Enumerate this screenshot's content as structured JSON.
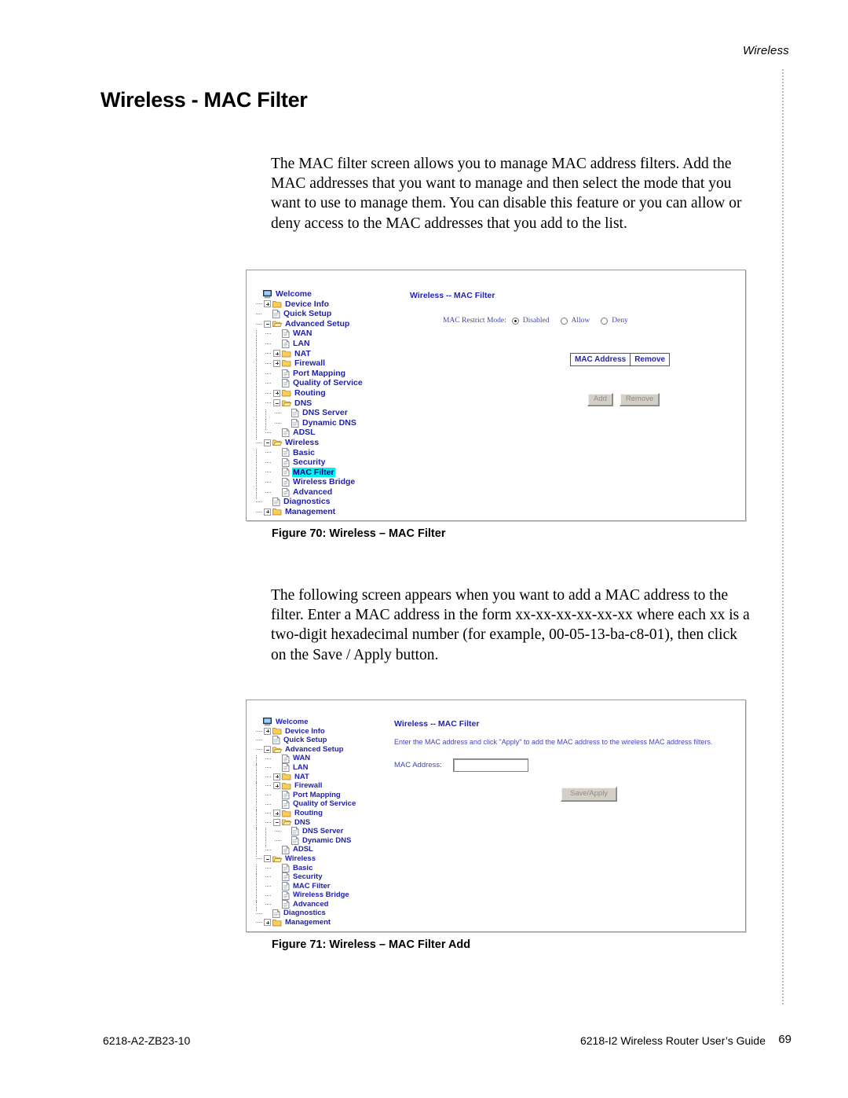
{
  "page": {
    "running_header": "Wireless",
    "title": "Wireless - MAC Filter",
    "paragraph_1": "The MAC filter screen allows you to manage MAC address filters. Add the MAC addresses that you want to manage and then select the mode that you want to use to manage them. You can disable this feature or you can allow or deny access to the MAC addresses that you add to the list.",
    "paragraph_2": "The following screen appears when you want to add a MAC address to the filter. Enter a MAC address in the form xx-xx-xx-xx-xx-xx where each xx is a two-digit hexadecimal number (for example, 00-05-13-ba-c8-01), then click on the Save / Apply button."
  },
  "figure_1": {
    "caption": "Figure 70: Wireless – MAC Filter",
    "panel_title": "Wireless -- MAC Filter",
    "restrict_label": "MAC Restrict Mode:",
    "radios": [
      {
        "label": "Disabled",
        "selected": true
      },
      {
        "label": "Allow",
        "selected": false
      },
      {
        "label": "Deny",
        "selected": false
      }
    ],
    "table_headers": [
      "MAC Address",
      "Remove"
    ],
    "buttons": [
      "Add",
      "Remove"
    ],
    "tree": [
      {
        "label": "Welcome",
        "depth": 0,
        "icon": "computer-icon",
        "toggle": "none"
      },
      {
        "label": "Device Info",
        "depth": 1,
        "icon": "folder-closed-icon",
        "toggle": "plus"
      },
      {
        "label": "Quick Setup",
        "depth": 1,
        "icon": "page-icon",
        "toggle": "none"
      },
      {
        "label": "Advanced Setup",
        "depth": 1,
        "icon": "folder-open-icon",
        "toggle": "minus"
      },
      {
        "label": "WAN",
        "depth": 2,
        "icon": "page-icon",
        "toggle": "none"
      },
      {
        "label": "LAN",
        "depth": 2,
        "icon": "page-icon",
        "toggle": "none"
      },
      {
        "label": "NAT",
        "depth": 2,
        "icon": "folder-closed-icon",
        "toggle": "plus"
      },
      {
        "label": "Firewall",
        "depth": 2,
        "icon": "folder-closed-icon",
        "toggle": "plus"
      },
      {
        "label": "Port Mapping",
        "depth": 2,
        "icon": "page-icon",
        "toggle": "none"
      },
      {
        "label": "Quality of Service",
        "depth": 2,
        "icon": "page-icon",
        "toggle": "none"
      },
      {
        "label": "Routing",
        "depth": 2,
        "icon": "folder-closed-icon",
        "toggle": "plus"
      },
      {
        "label": "DNS",
        "depth": 2,
        "icon": "folder-open-icon",
        "toggle": "minus"
      },
      {
        "label": "DNS Server",
        "depth": 3,
        "icon": "page-icon",
        "toggle": "none"
      },
      {
        "label": "Dynamic DNS",
        "depth": 3,
        "icon": "page-icon",
        "toggle": "none"
      },
      {
        "label": "ADSL",
        "depth": 2,
        "icon": "page-icon",
        "toggle": "none"
      },
      {
        "label": "Wireless",
        "depth": 1,
        "icon": "folder-open-icon",
        "toggle": "minus"
      },
      {
        "label": "Basic",
        "depth": 2,
        "icon": "page-icon",
        "toggle": "none"
      },
      {
        "label": "Security",
        "depth": 2,
        "icon": "page-icon",
        "toggle": "none"
      },
      {
        "label": "MAC Filter",
        "depth": 2,
        "icon": "page-icon",
        "toggle": "none",
        "selected": true
      },
      {
        "label": "Wireless Bridge",
        "depth": 2,
        "icon": "page-icon",
        "toggle": "none"
      },
      {
        "label": "Advanced",
        "depth": 2,
        "icon": "page-icon",
        "toggle": "none"
      },
      {
        "label": "Diagnostics",
        "depth": 1,
        "icon": "page-icon",
        "toggle": "none"
      },
      {
        "label": "Management",
        "depth": 1,
        "icon": "folder-closed-icon",
        "toggle": "plus"
      }
    ]
  },
  "figure_2": {
    "caption": "Figure 71: Wireless – MAC Filter Add",
    "panel_title": "Wireless -- MAC Filter",
    "help_text": "Enter the MAC address and click \"Apply\" to add the MAC address to the wireless MAC address filters.",
    "field_label": "MAC Address:",
    "field_value": "",
    "button": "Save/Apply",
    "tree": [
      {
        "label": "Welcome",
        "depth": 0,
        "icon": "computer-icon",
        "toggle": "none"
      },
      {
        "label": "Device Info",
        "depth": 1,
        "icon": "folder-closed-icon",
        "toggle": "plus"
      },
      {
        "label": "Quick Setup",
        "depth": 1,
        "icon": "page-icon",
        "toggle": "none"
      },
      {
        "label": "Advanced Setup",
        "depth": 1,
        "icon": "folder-open-icon",
        "toggle": "minus"
      },
      {
        "label": "WAN",
        "depth": 2,
        "icon": "page-icon",
        "toggle": "none"
      },
      {
        "label": "LAN",
        "depth": 2,
        "icon": "page-icon",
        "toggle": "none"
      },
      {
        "label": "NAT",
        "depth": 2,
        "icon": "folder-closed-icon",
        "toggle": "plus"
      },
      {
        "label": "Firewall",
        "depth": 2,
        "icon": "folder-closed-icon",
        "toggle": "plus"
      },
      {
        "label": "Port Mapping",
        "depth": 2,
        "icon": "page-icon",
        "toggle": "none"
      },
      {
        "label": "Quality of Service",
        "depth": 2,
        "icon": "page-icon",
        "toggle": "none"
      },
      {
        "label": "Routing",
        "depth": 2,
        "icon": "folder-closed-icon",
        "toggle": "plus"
      },
      {
        "label": "DNS",
        "depth": 2,
        "icon": "folder-open-icon",
        "toggle": "minus"
      },
      {
        "label": "DNS Server",
        "depth": 3,
        "icon": "page-icon",
        "toggle": "none"
      },
      {
        "label": "Dynamic DNS",
        "depth": 3,
        "icon": "page-icon",
        "toggle": "none"
      },
      {
        "label": "ADSL",
        "depth": 2,
        "icon": "page-icon",
        "toggle": "none"
      },
      {
        "label": "Wireless",
        "depth": 1,
        "icon": "folder-open-icon",
        "toggle": "minus"
      },
      {
        "label": "Basic",
        "depth": 2,
        "icon": "page-icon",
        "toggle": "none"
      },
      {
        "label": "Security",
        "depth": 2,
        "icon": "page-icon",
        "toggle": "none"
      },
      {
        "label": "MAC Filter",
        "depth": 2,
        "icon": "page-icon",
        "toggle": "none"
      },
      {
        "label": "Wireless Bridge",
        "depth": 2,
        "icon": "page-icon",
        "toggle": "none"
      },
      {
        "label": "Advanced",
        "depth": 2,
        "icon": "page-icon",
        "toggle": "none"
      },
      {
        "label": "Diagnostics",
        "depth": 1,
        "icon": "page-icon",
        "toggle": "none"
      },
      {
        "label": "Management",
        "depth": 1,
        "icon": "folder-closed-icon",
        "toggle": "plus"
      }
    ]
  },
  "footer": {
    "left": "6218-A2-ZB23-10",
    "right": "6218-I2 Wireless Router User’s Guide",
    "page_number": "69"
  },
  "colors": {
    "tree_text": "#2222aa",
    "panel_text": "#3333bb",
    "selection": "#00f0f0",
    "folder": "#ffcc66",
    "button_face": "#d4d0c8"
  }
}
